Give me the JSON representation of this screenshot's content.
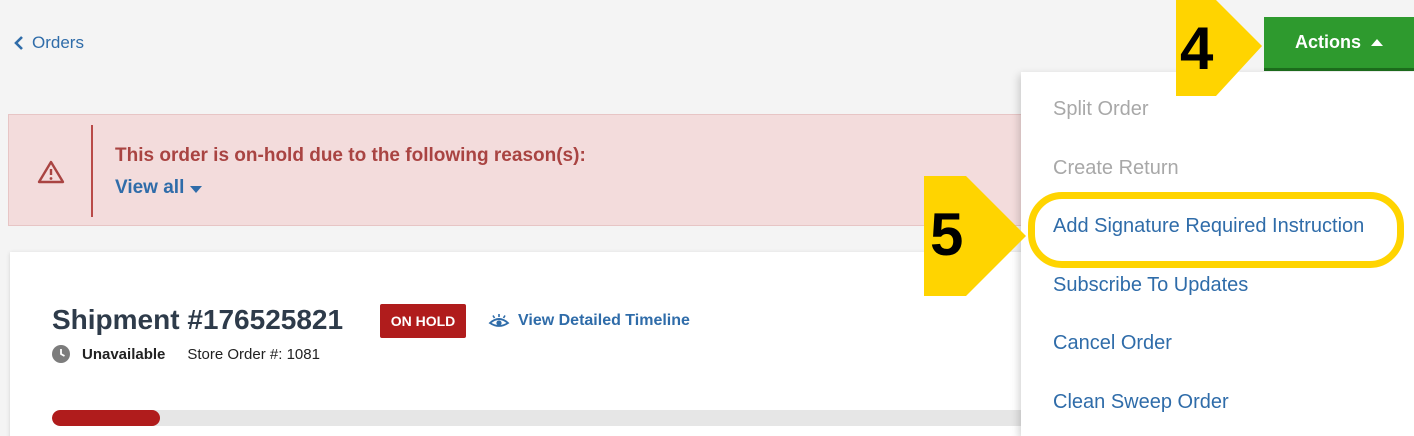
{
  "header": {
    "back_label": "Orders",
    "actions_label": "Actions"
  },
  "alert": {
    "message": "This order is on-hold due to the following reason(s):",
    "link_label": "View all"
  },
  "shipment": {
    "title": "Shipment #176525821",
    "status_badge": "ON HOLD",
    "timeline_link": "View Detailed Timeline",
    "delivery_status": "Unavailable",
    "store_order": "Store Order #: 1081",
    "progress_fraction": 0.11
  },
  "actions_menu": {
    "items": [
      {
        "label": "Split Order",
        "enabled": false
      },
      {
        "label": "Create Return",
        "enabled": false
      },
      {
        "label": "Add Signature Required Instruction",
        "enabled": true
      },
      {
        "label": "Subscribe To Updates",
        "enabled": true
      },
      {
        "label": "Cancel Order",
        "enabled": true
      },
      {
        "label": "Clean Sweep Order",
        "enabled": true
      }
    ]
  },
  "annotations": {
    "step_actions": "4",
    "step_signature": "5",
    "highlight_color": "#ffd400"
  },
  "colors": {
    "accent_green": "#2e9a2e",
    "link_blue": "#2f6ca9",
    "hold_red": "#b01c1c",
    "alert_bg": "#f3dcdc"
  }
}
